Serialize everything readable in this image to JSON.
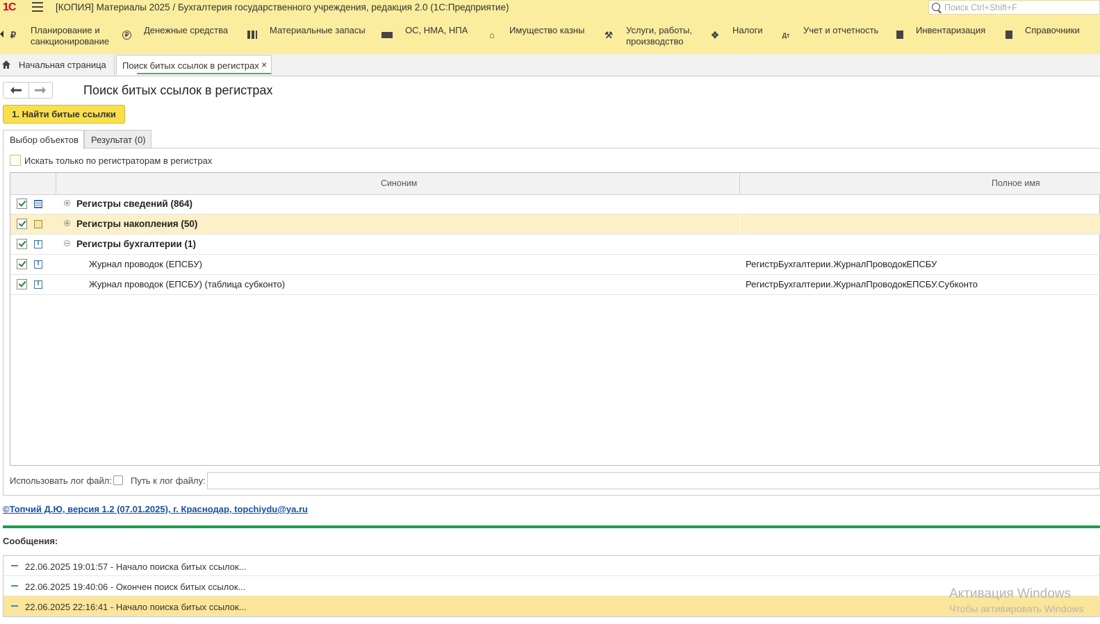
{
  "app": {
    "logo": "1С",
    "title": "[КОПИЯ] Материалы 2025 / Бухгалтерия государственного учреждения, редакция 2.0  (1С:Предприятие)",
    "search_placeholder": "Поиск Ctrl+Shift+F"
  },
  "sections": [
    {
      "label": "Планирование и\nсанкционирование",
      "icon": "planning-icon"
    },
    {
      "label": "Денежные средства",
      "icon": "ruble-icon"
    },
    {
      "label": "Материальные запасы",
      "icon": "grid-icon"
    },
    {
      "label": "ОС, НМА, НПА",
      "icon": "truck-icon"
    },
    {
      "label": "Имущество казны",
      "icon": "treasury-icon"
    },
    {
      "label": "Услуги, работы,\nпроизводство",
      "icon": "tools-icon"
    },
    {
      "label": "Налоги",
      "icon": "emblem-icon"
    },
    {
      "label": "Учет и отчетность",
      "icon": "accounting-icon"
    },
    {
      "label": "Инвентаризация",
      "icon": "inventory-icon"
    },
    {
      "label": "Справочники",
      "icon": "books-icon"
    }
  ],
  "tabs": {
    "home": "Начальная страница",
    "active": "Поиск битых ссылок в регистрах",
    "close": "×"
  },
  "form": {
    "title": "Поиск битых ссылок в регистрах",
    "find_button": "1. Найти битые ссылки",
    "tab_selection": "Выбор объектов",
    "tab_result": "Результат (0)",
    "option_label": "Искать только по регистраторам в регистрах"
  },
  "table": {
    "columns": [
      "Синоним",
      "Полное имя"
    ],
    "rows": [
      {
        "synonym": "Регистры сведений (864)",
        "full_name": "",
        "group": true,
        "expanded": false,
        "checked": true,
        "icon": "info-register-icon"
      },
      {
        "synonym": "Регистры накопления (50)",
        "full_name": "",
        "group": true,
        "expanded": false,
        "checked": true,
        "icon": "accumulation-register-icon",
        "selected": true
      },
      {
        "synonym": "Регистры бухгалтерии (1)",
        "full_name": "",
        "group": true,
        "expanded": true,
        "checked": true,
        "icon": "accounting-register-icon"
      },
      {
        "synonym": "Журнал проводок (ЕПСБУ)",
        "full_name": "РегистрБухгалтерии.ЖурналПроводокЕПСБУ",
        "group": false,
        "checked": true,
        "icon": "accounting-register-icon"
      },
      {
        "synonym": "Журнал проводок (ЕПСБУ) (таблица субконто)",
        "full_name": "РегистрБухгалтерии.ЖурналПроводокЕПСБУ.Субконто",
        "group": false,
        "checked": true,
        "icon": "accounting-register-icon"
      }
    ]
  },
  "log": {
    "use_log_label": "Использовать лог файл:",
    "path_label": "Путь к лог файлу:",
    "path_value": ""
  },
  "credit": "©Топчий Д.Ю, версия 1.2 (07.01.2025),  г. Краснодар, topchiydu@ya.ru",
  "messages": {
    "title": "Сообщения:",
    "items": [
      "22.06.2025 19:01:57 - Начало поиска битых ссылок...",
      "22.06.2025 19:40:06 - Окончен поиск битых ссылок...",
      "22.06.2025 22:16:41 - Начало поиска битых ссылок..."
    ]
  },
  "watermark": {
    "line1": "Активация Windows",
    "line2": "Чтобы активировать Windows"
  },
  "colors": {
    "accent_yellow": "#fbed9e",
    "button_yellow": "#f9e04b",
    "green": "#17a14a",
    "link": "#1a4fa3"
  }
}
